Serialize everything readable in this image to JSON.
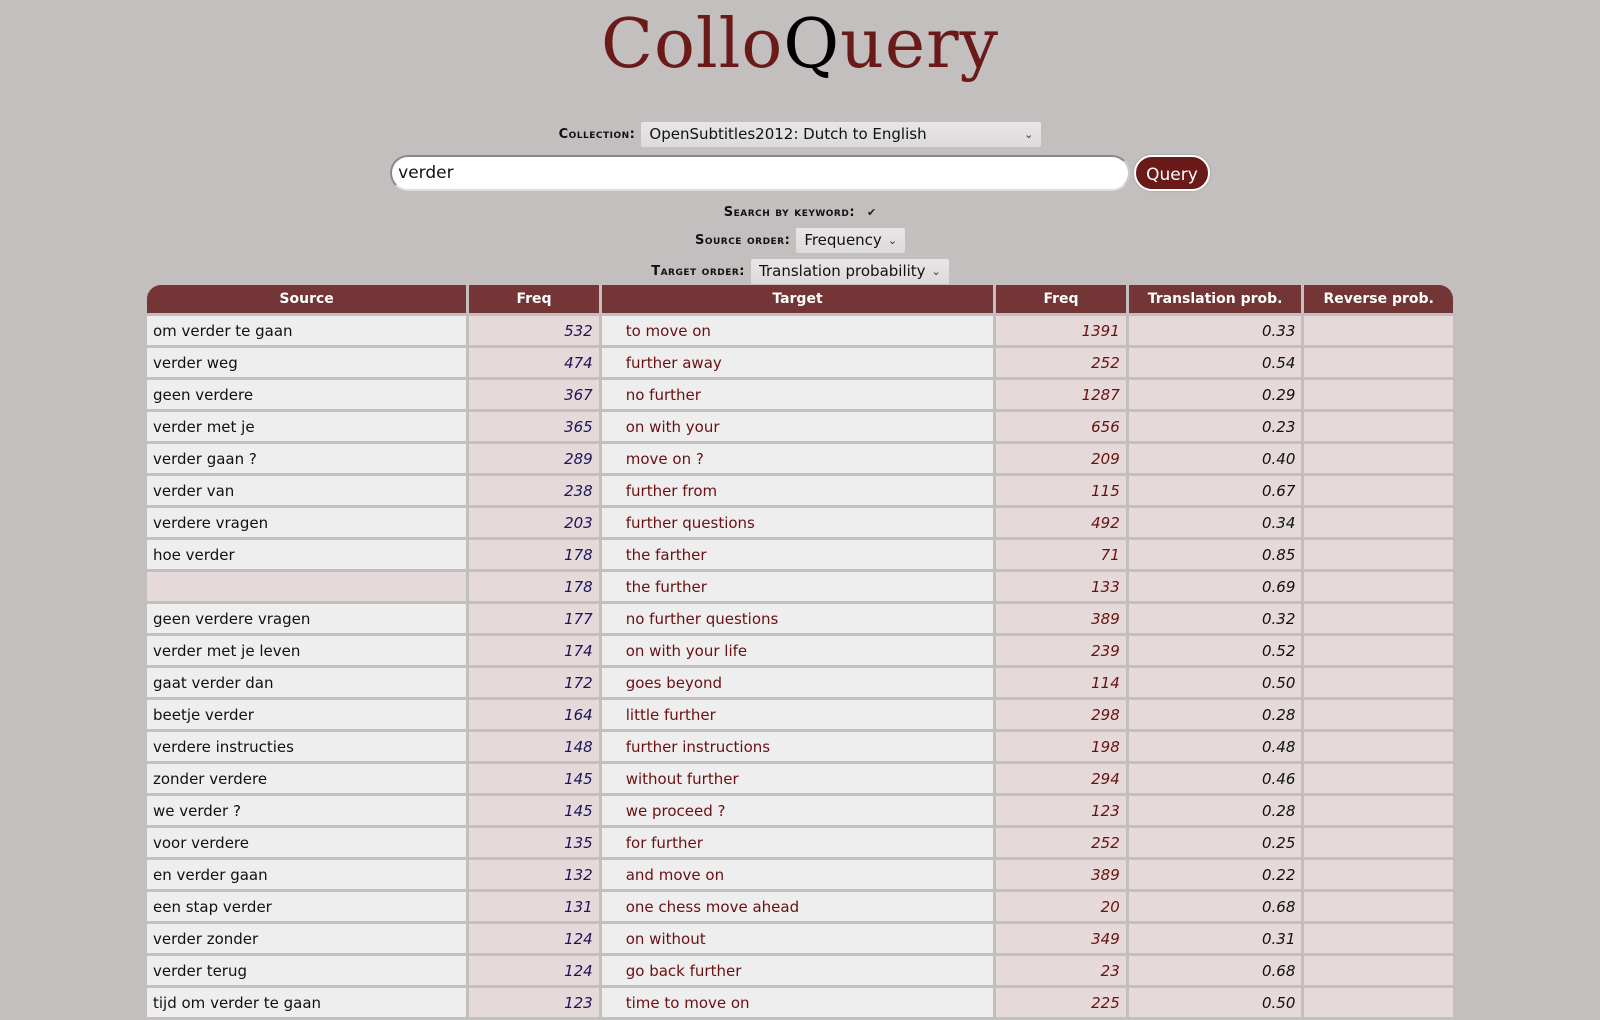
{
  "logo": {
    "part1": "Collo",
    "part2": "Q",
    "part3": "uery"
  },
  "collection": {
    "label": "Collection:",
    "value": "OpenSubtitles2012: Dutch to English"
  },
  "search": {
    "value": "verder",
    "button": "Query"
  },
  "keyword": {
    "label": "Search by keyword:",
    "checked": true,
    "check_glyph": "✔"
  },
  "source_order": {
    "label": "Source order:",
    "value": "Frequency"
  },
  "target_order": {
    "label": "Target order:",
    "value": "Translation probability"
  },
  "chevron": "⌄",
  "table": {
    "headers": [
      "Source",
      "Freq",
      "Target",
      "Freq",
      "Translation prob.",
      "Reverse prob."
    ],
    "rows": [
      {
        "source": "om verder te gaan",
        "sfreq": "532",
        "target": "to move on",
        "tfreq": "1391",
        "tprob": "0.33",
        "rprob": ""
      },
      {
        "source": "verder weg",
        "sfreq": "474",
        "target": "further away",
        "tfreq": "252",
        "tprob": "0.54",
        "rprob": ""
      },
      {
        "source": "geen verdere",
        "sfreq": "367",
        "target": "no further",
        "tfreq": "1287",
        "tprob": "0.29",
        "rprob": ""
      },
      {
        "source": "verder met je",
        "sfreq": "365",
        "target": "on with your",
        "tfreq": "656",
        "tprob": "0.23",
        "rprob": ""
      },
      {
        "source": "verder gaan ?",
        "sfreq": "289",
        "target": "move on ?",
        "tfreq": "209",
        "tprob": "0.40",
        "rprob": ""
      },
      {
        "source": "verder van",
        "sfreq": "238",
        "target": "further from",
        "tfreq": "115",
        "tprob": "0.67",
        "rprob": ""
      },
      {
        "source": "verdere vragen",
        "sfreq": "203",
        "target": "further questions",
        "tfreq": "492",
        "tprob": "0.34",
        "rprob": ""
      },
      {
        "source": "hoe verder",
        "sfreq": "178",
        "target": "the farther",
        "tfreq": "71",
        "tprob": "0.85",
        "rprob": ""
      },
      {
        "source": "",
        "sfreq": "178",
        "target": "the further",
        "tfreq": "133",
        "tprob": "0.69",
        "rprob": ""
      },
      {
        "source": "geen verdere vragen",
        "sfreq": "177",
        "target": "no further questions",
        "tfreq": "389",
        "tprob": "0.32",
        "rprob": ""
      },
      {
        "source": "verder met je leven",
        "sfreq": "174",
        "target": "on with your life",
        "tfreq": "239",
        "tprob": "0.52",
        "rprob": ""
      },
      {
        "source": "gaat verder dan",
        "sfreq": "172",
        "target": "goes beyond",
        "tfreq": "114",
        "tprob": "0.50",
        "rprob": ""
      },
      {
        "source": "beetje verder",
        "sfreq": "164",
        "target": "little further",
        "tfreq": "298",
        "tprob": "0.28",
        "rprob": ""
      },
      {
        "source": "verdere instructies",
        "sfreq": "148",
        "target": "further instructions",
        "tfreq": "198",
        "tprob": "0.48",
        "rprob": ""
      },
      {
        "source": "zonder verdere",
        "sfreq": "145",
        "target": "without further",
        "tfreq": "294",
        "tprob": "0.46",
        "rprob": ""
      },
      {
        "source": "we verder ?",
        "sfreq": "145",
        "target": "we proceed ?",
        "tfreq": "123",
        "tprob": "0.28",
        "rprob": ""
      },
      {
        "source": "voor verdere",
        "sfreq": "135",
        "target": "for further",
        "tfreq": "252",
        "tprob": "0.25",
        "rprob": ""
      },
      {
        "source": "en verder gaan",
        "sfreq": "132",
        "target": "and move on",
        "tfreq": "389",
        "tprob": "0.22",
        "rprob": ""
      },
      {
        "source": "een stap verder",
        "sfreq": "131",
        "target": "one chess move ahead",
        "tfreq": "20",
        "tprob": "0.68",
        "rprob": ""
      },
      {
        "source": "verder zonder",
        "sfreq": "124",
        "target": "on without",
        "tfreq": "349",
        "tprob": "0.31",
        "rprob": ""
      },
      {
        "source": "verder terug",
        "sfreq": "124",
        "target": "go back further",
        "tfreq": "23",
        "tprob": "0.68",
        "rprob": ""
      },
      {
        "source": "tijd om verder te gaan",
        "sfreq": "123",
        "target": "time to move on",
        "tfreq": "225",
        "tprob": "0.50",
        "rprob": ""
      }
    ]
  }
}
